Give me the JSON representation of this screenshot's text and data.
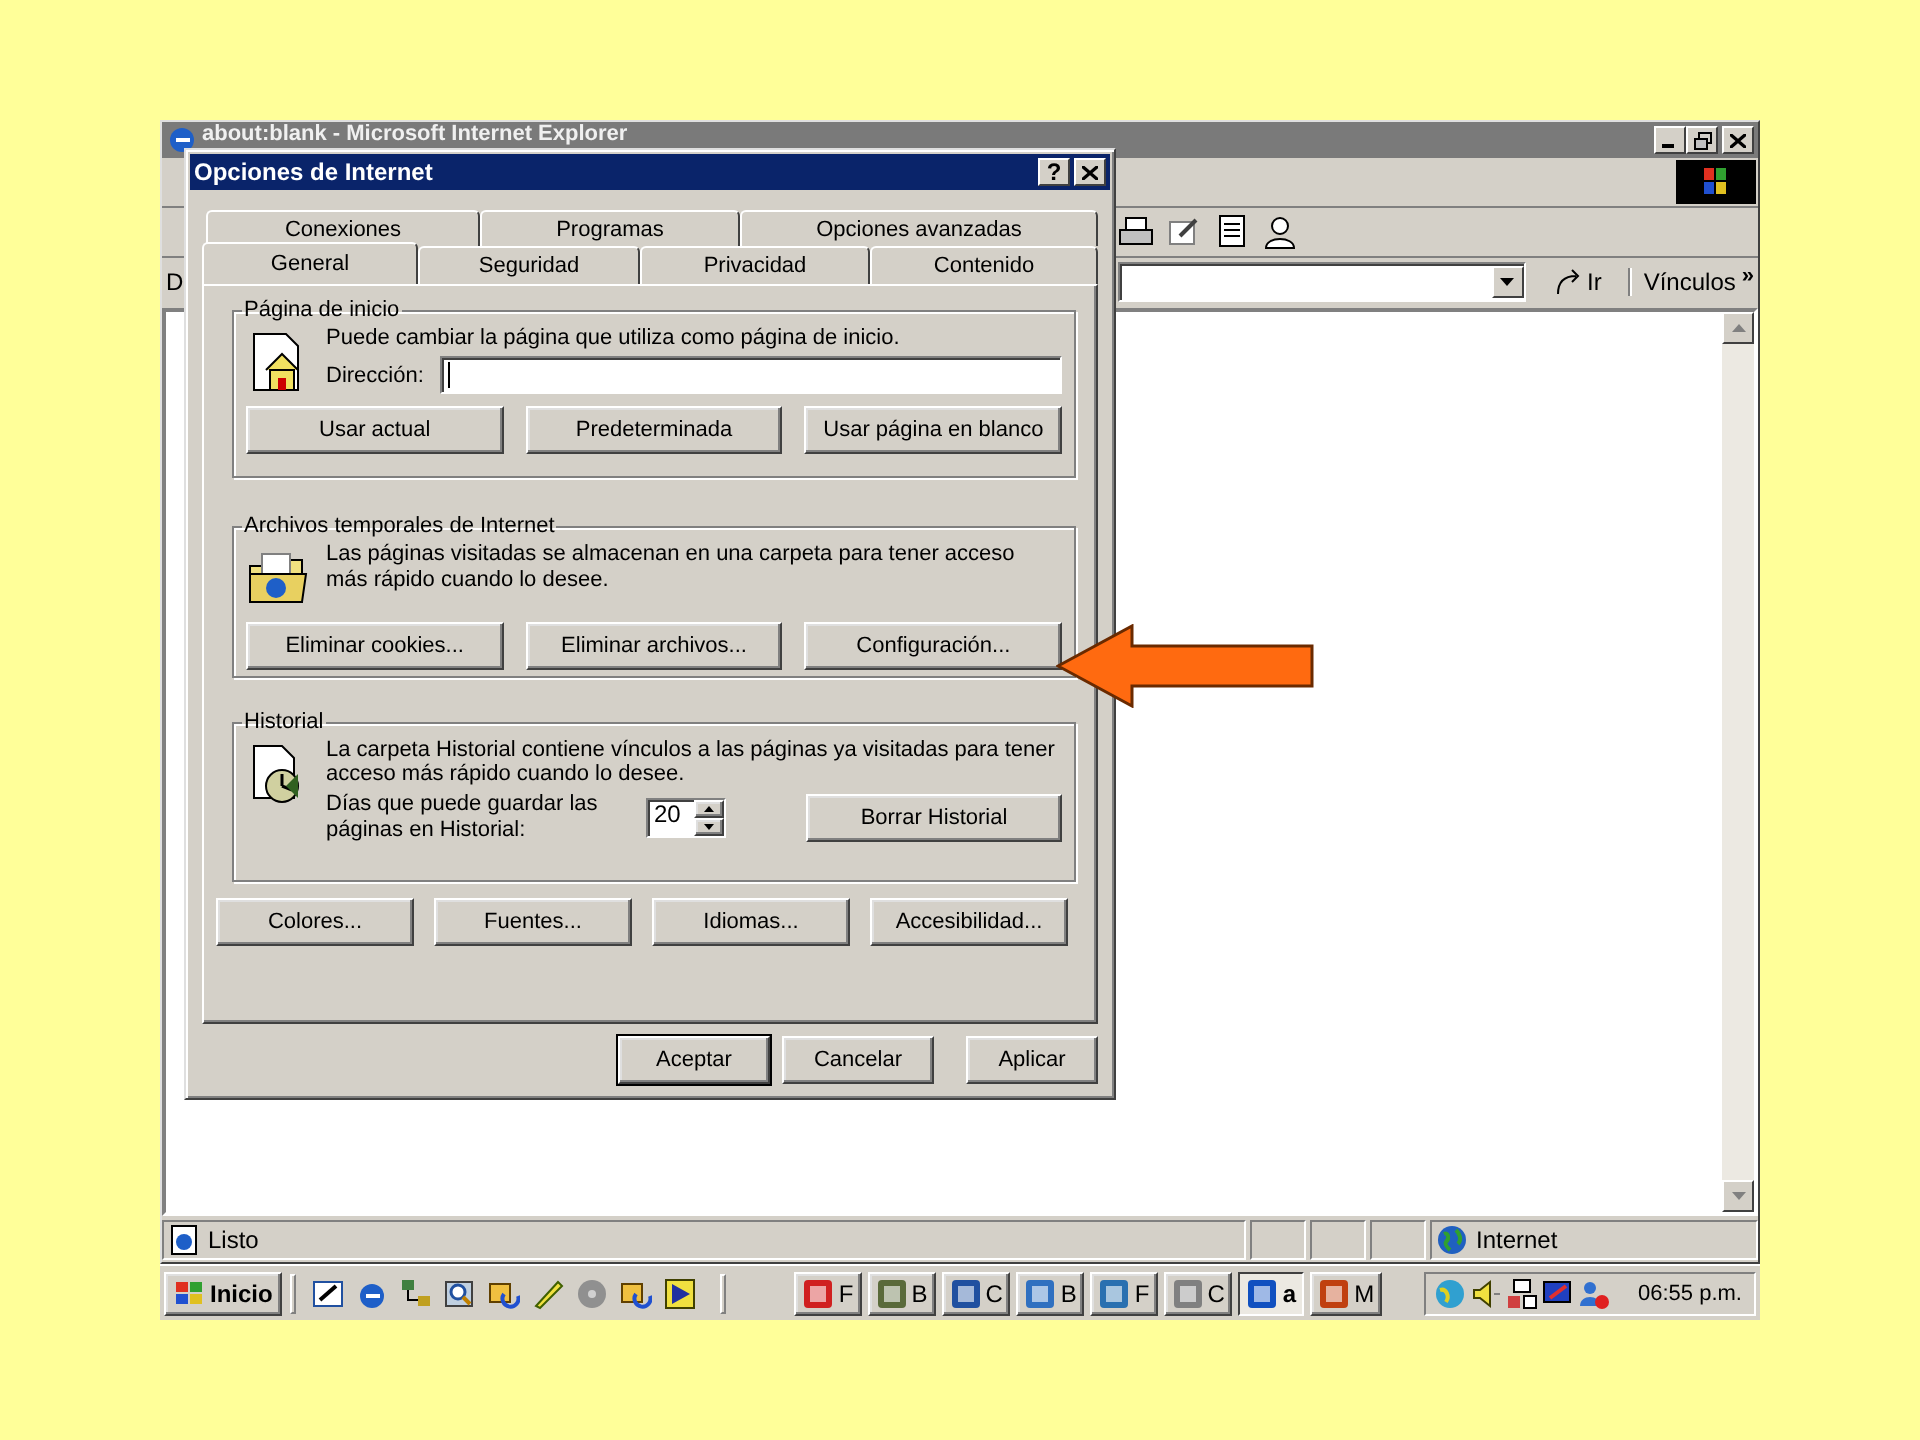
{
  "browser": {
    "title": "about:blank - Microsoft Internet Explorer",
    "address_label": "D",
    "go": "Ir",
    "links": "Vínculos",
    "links_more": "»",
    "status": "Listo",
    "zone": "Internet"
  },
  "dialog": {
    "title": "Opciones de Internet",
    "help": "?",
    "tab_rows": [
      {
        "tabs": [
          {
            "label": "Conexiones",
            "selected": false
          },
          {
            "label": "Programas",
            "selected": false
          },
          {
            "label": "Opciones avanzadas",
            "selected": false
          }
        ]
      },
      {
        "tabs": [
          {
            "label": "General",
            "selected": true
          },
          {
            "label": "Seguridad",
            "selected": false
          },
          {
            "label": "Privacidad",
            "selected": false
          },
          {
            "label": "Contenido",
            "selected": false
          }
        ]
      }
    ],
    "home": {
      "title": "Página de inicio",
      "text": "Puede cambiar la página que utiliza como página de inicio.",
      "address_label": "Dirección:",
      "buttons": [
        "Usar actual",
        "Predeterminada",
        "Usar página en blanco"
      ]
    },
    "temp": {
      "title": "Archivos temporales de Internet",
      "text": "Las páginas visitadas se almacenan en una carpeta para tener acceso más rápido cuando lo desee.",
      "buttons": [
        "Eliminar cookies...",
        "Eliminar archivos...",
        "Configuración..."
      ]
    },
    "history": {
      "title": "Historial",
      "text": "La carpeta Historial contiene vínculos a las páginas ya visitadas para tener acceso más rápido cuando lo desee.",
      "days_label": "Días que puede guardar las páginas en Historial:",
      "days_value": "20",
      "button": "Borrar Historial"
    },
    "extra_buttons": [
      "Colores...",
      "Fuentes...",
      "Idiomas...",
      "Accesibilidad..."
    ],
    "footer_buttons": [
      {
        "label": "Aceptar",
        "default": true
      },
      {
        "label": "Cancelar",
        "default": false
      },
      {
        "label": "Aplicar",
        "default": false
      }
    ]
  },
  "taskbar": {
    "start": "Inicio",
    "clock": "06:55 p.m.",
    "tasks": [
      {
        "label": "F",
        "selected": false
      },
      {
        "label": "B",
        "selected": false
      },
      {
        "label": "C",
        "selected": false
      },
      {
        "label": "B",
        "selected": false
      },
      {
        "label": "F",
        "selected": false
      },
      {
        "label": "C",
        "selected": false
      },
      {
        "label": "a",
        "selected": true
      },
      {
        "label": "M",
        "selected": false
      }
    ]
  }
}
